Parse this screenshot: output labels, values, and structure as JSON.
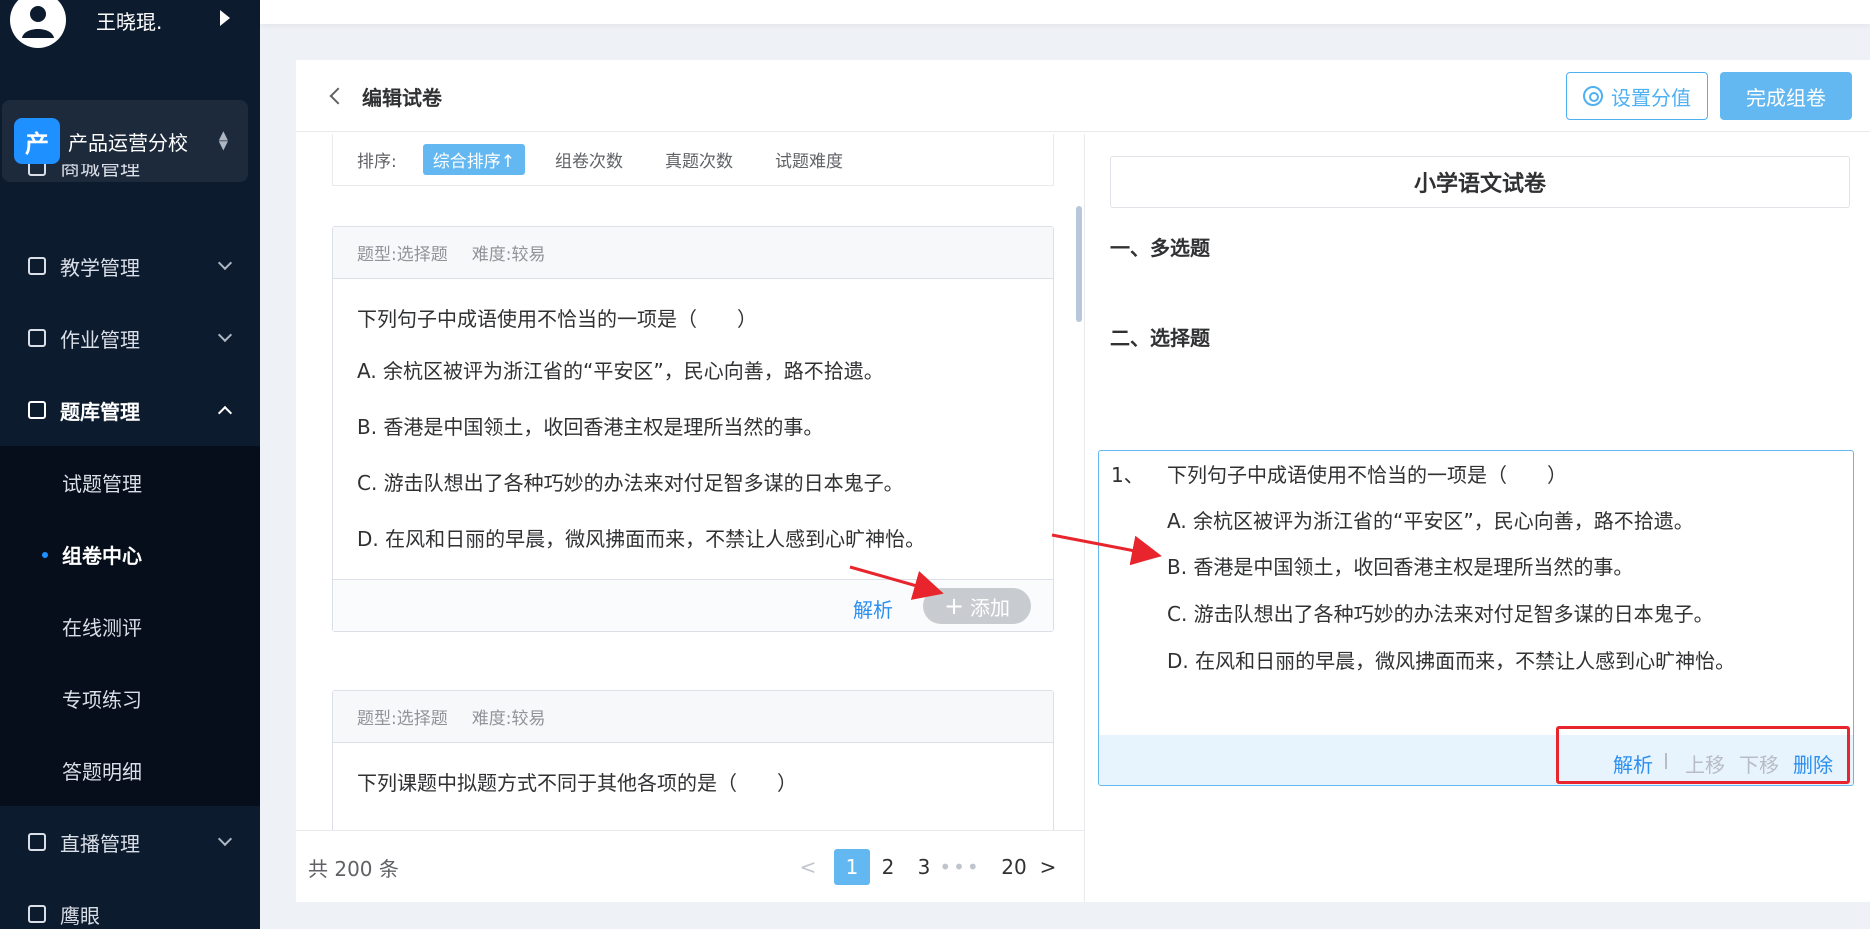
{
  "user": {
    "name": "王晓琨."
  },
  "school": {
    "icon_char": "产",
    "name": "产品运营分校"
  },
  "menu": {
    "partial_item": "商城管理",
    "teaching": "教学管理",
    "homework": "作业管理",
    "question_bank": "题库管理",
    "sub_items": [
      "试题管理",
      "组卷中心",
      "在线测评",
      "专项练习",
      "答题明细"
    ],
    "live": "直播管理",
    "eagle_eye": "鹰眼"
  },
  "header": {
    "title": "编辑试卷",
    "setting_button": "设置分值",
    "finish_button": "完成组卷"
  },
  "sort": {
    "label": "排序:",
    "options": [
      "综合排序↑",
      "组卷次数",
      "真题次数",
      "试题难度"
    ]
  },
  "question_cards": [
    {
      "type": "题型:选择题",
      "difficulty": "难度:较易",
      "stem": "下列句子中成语使用不恰当的一项是（　　）",
      "options": [
        "A.  余杭区被评为浙江省的“平安区”，民心向善，路不拾遗。",
        "B.  香港是中国领土，收回香港主权是理所当然的事。",
        "C.  游击队想出了各种巧妙的办法来对付足智多谋的日本鬼子。",
        "D.  在风和日丽的早晨，微风拂面而来，不禁让人感到心旷神怡。"
      ],
      "analysis_link": "解析",
      "add_button": "添加"
    },
    {
      "type": "题型:选择题",
      "difficulty": "难度:较易",
      "stem": "下列课题中拟题方式不同于其他各项的是（　　）"
    }
  ],
  "pagination": {
    "total": "共 200 条",
    "pages": [
      "1",
      "2",
      "3"
    ],
    "ellipsis": "•••",
    "last": "20",
    "prev": "<",
    "next": ">"
  },
  "paper": {
    "title": "小学语文试卷",
    "section1": "一、多选题",
    "section2": "二、选择题",
    "selected": {
      "number": "1、",
      "stem": "下列句子中成语使用不恰当的一项是（　　）",
      "options": [
        "A.  余杭区被评为浙江省的“平安区”，民心向善，路不拾遗。",
        "B.  香港是中国领土，收回香港主权是理所当然的事。",
        "C.  游击队想出了各种巧妙的办法来对付足智多谋的日本鬼子。",
        "D.  在风和日丽的早晨，微风拂面而来，不禁让人感到心旷神怡。"
      ],
      "actions": {
        "analysis": "解析",
        "move_up": "上移",
        "move_down": "下移",
        "delete": "删除"
      }
    }
  },
  "colors": {
    "sidebar_bg": "#0c1b2e",
    "accent": "#63b8f2",
    "link": "#2b8ff0",
    "annotation_red": "#e8252d"
  }
}
